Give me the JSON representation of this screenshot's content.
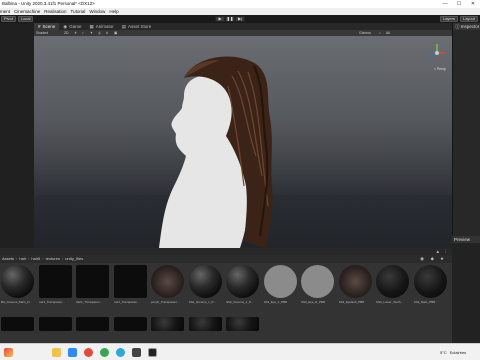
{
  "window": {
    "title": "Balbina - Unity 2020.3.41f1 Personal* <DX12>",
    "controls": [
      "—",
      "☐",
      "✕"
    ]
  },
  "menu": [
    "ment",
    "Cinemachine",
    "Realisation",
    "Tutorial",
    "Window",
    "Help"
  ],
  "toolbar": {
    "pivot": "Pivot",
    "local": "Local",
    "layers": "Layers",
    "layout": "Layout"
  },
  "scene_tabs": [
    "Scene",
    "Game",
    "Animator",
    "Asset Store"
  ],
  "scene_toolbar": {
    "shading": "Shaded",
    "mode_2d": "2D",
    "gizmos": "Gizmos",
    "search": "All"
  },
  "gizmo": {
    "label": "< Persp"
  },
  "inspector": {
    "title": "Inspector"
  },
  "preview": {
    "title": "Preview"
  },
  "project": {
    "breadcrumb": [
      "Assets",
      "hair",
      "hair5",
      "textures",
      "untty_files"
    ]
  },
  "assets": [
    {
      "label": "BA_Grooms_Main_Ft",
      "style": "sphere"
    },
    {
      "label": "hair1_Transparen...",
      "style": "plain"
    },
    {
      "label": "hair1_Transparen...",
      "style": "plain"
    },
    {
      "label": "hair1_Transparen...",
      "style": "plain"
    },
    {
      "label": "ponyb_Transparent...",
      "style": "photo"
    },
    {
      "label": "SS2_Grooms_1_P...",
      "style": "sphere"
    },
    {
      "label": "SS2_Grooms_1_P...",
      "style": "sphere"
    },
    {
      "label": "SS3_Eye_1_PBR",
      "style": "gray"
    },
    {
      "label": "SS3_Eye_R_PBR",
      "style": "gray"
    },
    {
      "label": "SS3_Eyelash_PBR",
      "style": "photo"
    },
    {
      "label": "SS3_Lower_Teeth...",
      "style": "dark2"
    },
    {
      "label": "SS3_Nails_PBR",
      "style": "dark2"
    }
  ],
  "taskbar": {
    "temperature": "5°C",
    "weather": "Eclairées"
  },
  "colors": {
    "accent": "#3a72b0",
    "scene_bg": "#55585d"
  }
}
